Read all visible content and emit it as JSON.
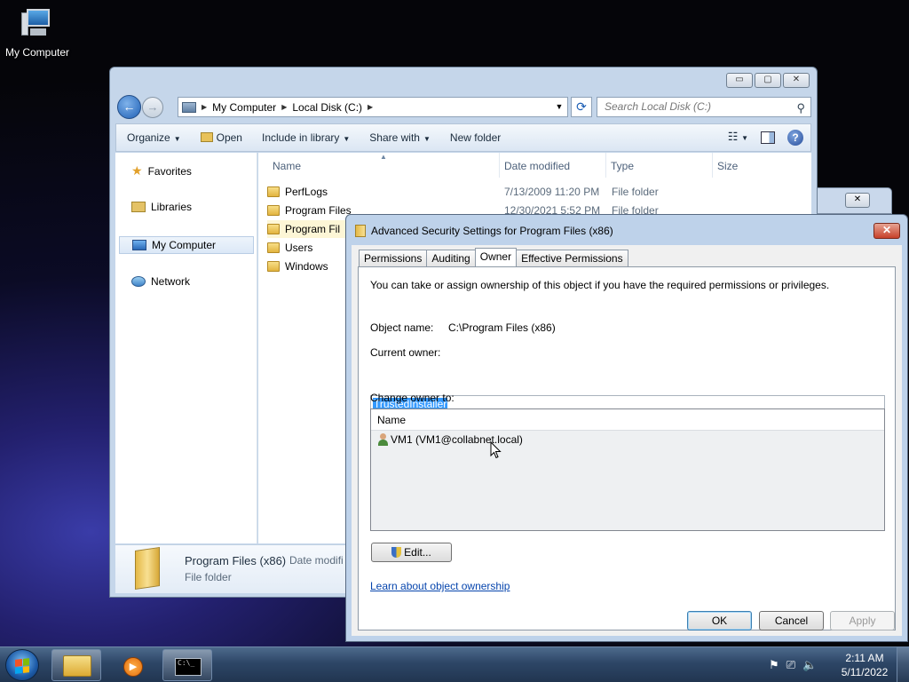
{
  "desktop": {
    "icon_label": "My Computer"
  },
  "explorer": {
    "window_buttons": [
      "▭",
      "▢",
      "✕"
    ],
    "breadcrumb": [
      "My Computer",
      "Local Disk (C:)"
    ],
    "search_placeholder": "Search Local Disk (C:)",
    "toolbar": {
      "organize": "Organize",
      "open": "Open",
      "include_in_library": "Include in library",
      "share_with": "Share with",
      "new_folder": "New folder"
    },
    "nav": {
      "favorites": "Favorites",
      "libraries": "Libraries",
      "my_computer": "My Computer",
      "network": "Network"
    },
    "columns": {
      "name": "Name",
      "date": "Date modified",
      "type": "Type",
      "size": "Size"
    },
    "files": [
      {
        "name": "PerfLogs",
        "date": "7/13/2009 11:20 PM",
        "type": "File folder"
      },
      {
        "name": "Program Files",
        "date": "12/30/2021 5:52 PM",
        "type": "File folder"
      },
      {
        "name": "Program Fil",
        "date": "",
        "type": ""
      },
      {
        "name": "Users",
        "date": "",
        "type": ""
      },
      {
        "name": "Windows",
        "date": "",
        "type": ""
      }
    ],
    "details": {
      "name": "Program Files (x86)",
      "date_label": "Date modifi",
      "type": "File folder"
    }
  },
  "dialog": {
    "title": "Advanced Security Settings for Program Files (x86)",
    "close": "✕",
    "tabs": [
      "Permissions",
      "Auditing",
      "Owner",
      "Effective Permissions"
    ],
    "active_tab": "Owner",
    "intro": "You can take or assign ownership of this object if you have the required permissions or privileges.",
    "object_name_label": "Object name:",
    "object_name_value": "C:\\Program Files (x86)",
    "current_owner_label": "Current owner:",
    "current_owner_value": "TrustedInstaller",
    "change_owner_label": "Change owner to:",
    "list_header": "Name",
    "list_items": [
      "VM1 (VM1@collabnet.local)"
    ],
    "edit_button": "Edit...",
    "learn_link": "Learn about object ownership",
    "ok_button": "OK",
    "cancel_button": "Cancel",
    "apply_button": "Apply"
  },
  "taskbar": {
    "cmd_icon_text": "C:\\_",
    "time": "2:11 AM",
    "date": "5/11/2022"
  }
}
